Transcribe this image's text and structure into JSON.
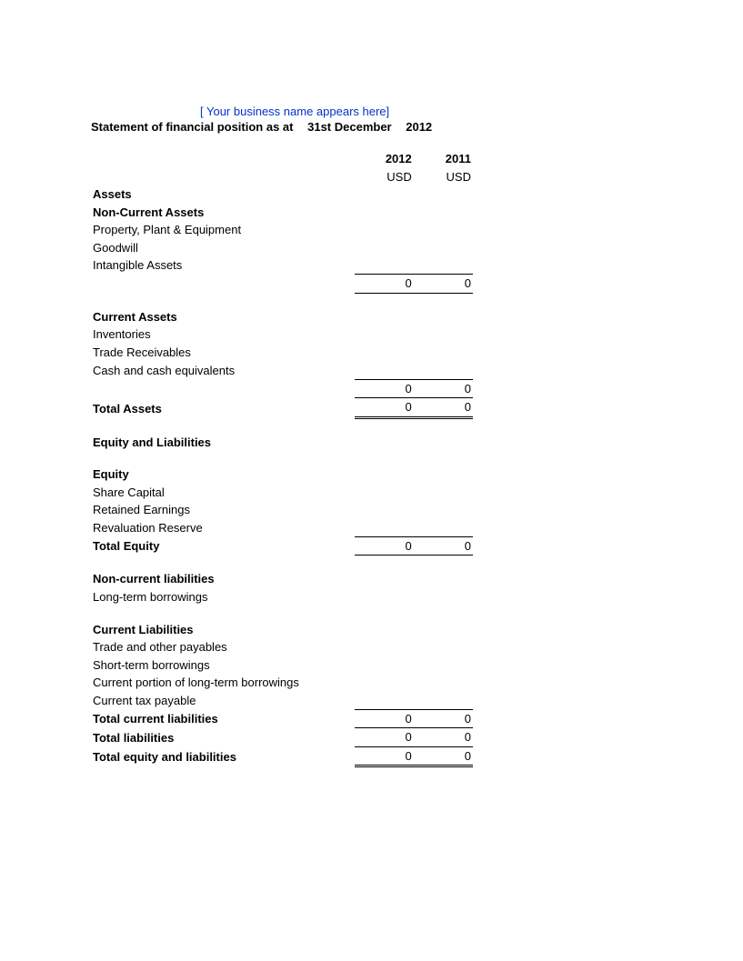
{
  "header": {
    "business_placeholder": "[ Your business name appears here]",
    "title_prefix": "Statement of financial position as at",
    "date": "31st December",
    "year": "2012"
  },
  "columns": {
    "year_a": "2012",
    "year_b": "2011",
    "currency_a": "USD",
    "currency_b": "USD"
  },
  "sections": {
    "assets_heading": "Assets",
    "non_current_assets_heading": "Non-Current Assets",
    "ppe": "Property, Plant & Equipment",
    "goodwill": "Goodwill",
    "intangible": "Intangible Assets",
    "non_current_total_a": "0",
    "non_current_total_b": "0",
    "current_assets_heading": "Current Assets",
    "inventories": "Inventories",
    "trade_receivables": "Trade Receivables",
    "cash": "Cash and cash equivalents",
    "current_assets_total_a": "0",
    "current_assets_total_b": "0",
    "total_assets_label": "Total Assets",
    "total_assets_a": "0",
    "total_assets_b": "0",
    "equity_liabilities_heading": "Equity and Liabilities",
    "equity_heading": "Equity",
    "share_capital": "Share Capital",
    "retained_earnings": "Retained Earnings",
    "revaluation_reserve": "Revaluation Reserve",
    "total_equity_label": "Total Equity",
    "total_equity_a": "0",
    "total_equity_b": "0",
    "non_current_liab_heading": "Non-current liabilities",
    "long_term_borrowings": "Long-term borrowings",
    "current_liab_heading": "Current Liabilities",
    "trade_payables": "Trade and other payables",
    "short_term_borrowings": "Short-term borrowings",
    "current_portion_lt": "Current portion of long-term borrowings",
    "current_tax_payable": "Current tax payable",
    "total_current_liab_label": "Total current liabilities",
    "total_current_liab_a": "0",
    "total_current_liab_b": "0",
    "total_liab_label": "Total liabilities",
    "total_liab_a": "0",
    "total_liab_b": "0",
    "total_equity_liab_label": "Total equity and liabilities",
    "total_equity_liab_a": "0",
    "total_equity_liab_b": "0"
  }
}
